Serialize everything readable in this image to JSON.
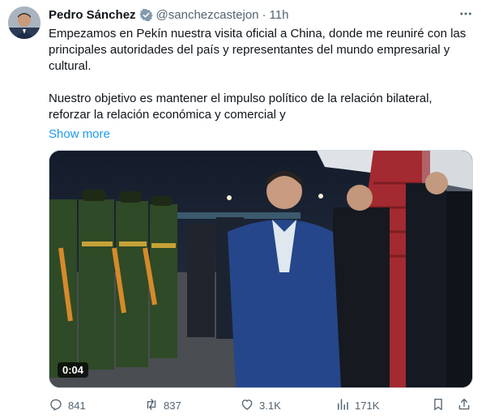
{
  "author": {
    "name": "Pedro Sánchez",
    "handle": "@sanchezcastejon",
    "separator": "·",
    "time": "11h"
  },
  "tweet": {
    "paragraphs": [
      "Empezamos en Pekín nuestra visita oficial a China, donde me reuniré con las principales autoridades del país y representantes del mundo empresarial y cultural.",
      "Nuestro objetivo es mantener el impulso político de la relación bilateral, reforzar la relación económica y comercial y"
    ],
    "show_more": "Show more"
  },
  "media": {
    "type": "video",
    "duration": "0:04"
  },
  "actions": {
    "replies": "841",
    "reposts": "837",
    "likes": "3.1K",
    "views": "171K"
  },
  "icons": {
    "verified": "verified-badge-icon",
    "more": "more-horizontal-icon",
    "reply": "reply-icon",
    "repost": "repost-icon",
    "like": "heart-icon",
    "views": "views-chart-icon",
    "bookmark": "bookmark-icon",
    "share": "share-icon"
  },
  "colors": {
    "link": "#1d9bf0",
    "secondary_text": "#536471",
    "primary_text": "#0f1419"
  }
}
